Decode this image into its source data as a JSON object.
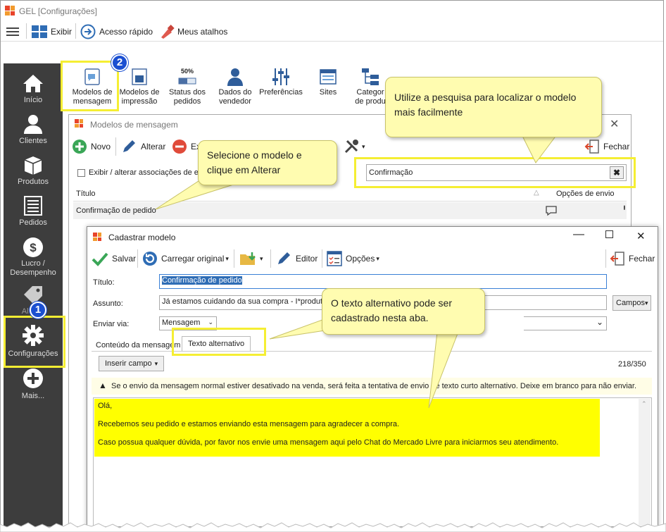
{
  "app": {
    "title": "GEL [Configurações]"
  },
  "menubar": {
    "exibir": "Exibir",
    "acesso": "Acesso rápido",
    "atalhos": "Meus atalhos"
  },
  "sidebar": {
    "items": [
      {
        "label": "Início",
        "icon": "home-icon"
      },
      {
        "label": "Clientes",
        "icon": "user-icon"
      },
      {
        "label": "Produtos",
        "icon": "box-icon"
      },
      {
        "label": "Pedidos",
        "icon": "list-icon"
      },
      {
        "label": "Lucro / Desempenho",
        "icon": "dollar-icon"
      },
      {
        "label": "Alterar",
        "icon": "tag-icon"
      },
      {
        "label": "Configurações",
        "icon": "gear-icon"
      },
      {
        "label": "Mais...",
        "icon": "plus-icon"
      }
    ]
  },
  "ribbon": {
    "items": [
      {
        "label": "Modelos de mensagem"
      },
      {
        "label": "Modelos de impressão"
      },
      {
        "label": "Status dos pedidos",
        "badge": "50%"
      },
      {
        "label": "Dados do vendedor"
      },
      {
        "label": "Preferências"
      },
      {
        "label": "Sites"
      },
      {
        "label": "Categor de produ"
      }
    ]
  },
  "badges": {
    "one": "1",
    "two": "2"
  },
  "modelos": {
    "title": "Modelos de mensagem",
    "novo": "Novo",
    "alterar": "Alterar",
    "excluir": "Ex",
    "fechar": "Fechar",
    "checkbox_label": "Exibir / alterar associações de en",
    "search_value": "Confirmação",
    "col_titulo": "Título",
    "col_opcoes": "Opções de envio",
    "row": "Confirmação de pedido"
  },
  "cadastrar": {
    "title": "Cadastrar modelo",
    "salvar": "Salvar",
    "carregar": "Carregar original",
    "editor": "Editor",
    "opcoes": "Opções",
    "fechar": "Fechar",
    "titulo_label": "Título:",
    "titulo_value": "Confirmação de pedido",
    "assunto_label": "Assunto:",
    "assunto_value": "Já estamos cuidando da sua compra - I*produto",
    "campos": "Campos",
    "enviar_label": "Enviar via:",
    "enviar_value": "Mensagem",
    "tab_conteudo": "Conteúdo da mensagem",
    "tab_texto": "Texto alternativo",
    "inserir": "Inserir campo",
    "count": "218/350",
    "warning": "Se o envio da mensagem normal estiver desativado na venda, será feita a tentativa de envio de texto curto alternativo. Deixe em branco para não enviar.",
    "body_lines": [
      "Olá,",
      "Recebemos seu pedido e estamos enviando esta mensagem para agradecer a compra.",
      "Caso possua qualquer dúvida,  por favor nos envie uma mensagem aqui pelo Chat do Mercado Livre para iniciarmos seu atendimento."
    ]
  },
  "callouts": {
    "pesquisa": "Utilize a pesquisa para localizar o modelo mais facilmente",
    "selecione": "Selecione o modelo e clique em Alterar",
    "texto_alt": "O texto alternativo pode ser cadastrado nesta aba."
  }
}
